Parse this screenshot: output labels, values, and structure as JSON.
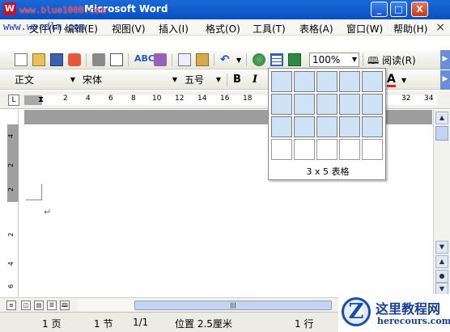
{
  "window": {
    "title": "Microsoft Word",
    "logo_letter": "W",
    "min_label": "_",
    "max_label": "□",
    "close_label": "X"
  },
  "watermark": {
    "top_url": "www.blue1000.com",
    "menu_url": "www.wordlm.com"
  },
  "menu": {
    "items": [
      {
        "label": "文件(F)"
      },
      {
        "label": "编辑(E)"
      },
      {
        "label": "视图(V)"
      },
      {
        "label": "插入(I)"
      },
      {
        "label": "格式(O)"
      },
      {
        "label": "工具(T)"
      },
      {
        "label": "表格(A)"
      },
      {
        "label": "窗口(W)"
      },
      {
        "label": "帮助(H)"
      }
    ],
    "close_doc": "×"
  },
  "toolbar_standard": {
    "zoom": "100%",
    "read_label": "阅读(R)"
  },
  "toolbar_format": {
    "style": "正文",
    "font": "宋体",
    "size": "五号",
    "bold": "B",
    "italic": "I",
    "font_color_letter": "A"
  },
  "ruler": {
    "corner": "L",
    "ticks": [
      "2",
      "4",
      "6",
      "8",
      "10",
      "12",
      "14",
      "16",
      "18",
      "32",
      "34"
    ]
  },
  "vruler": {
    "ticks": [
      "4",
      "2",
      "2",
      "2",
      "4",
      "6"
    ]
  },
  "table_picker": {
    "rows": 4,
    "cols": 5,
    "selected_rows": 3,
    "selected_cols": 5,
    "label": "3 x 5 表格"
  },
  "document": {
    "paragraph_mark": "↵"
  },
  "statusbar": {
    "page": "1 页",
    "section": "1 节",
    "page_of": "1/1",
    "position": "位置 2.5厘米",
    "line": "1 行"
  },
  "site_logo": {
    "letter": "Z",
    "name_cn": "这里教程网",
    "domain": "herecours.com"
  },
  "colors": {
    "titlebar": "#0a4fc4",
    "grid_selected": "#cfe3f6",
    "font_color": "#e02020"
  }
}
